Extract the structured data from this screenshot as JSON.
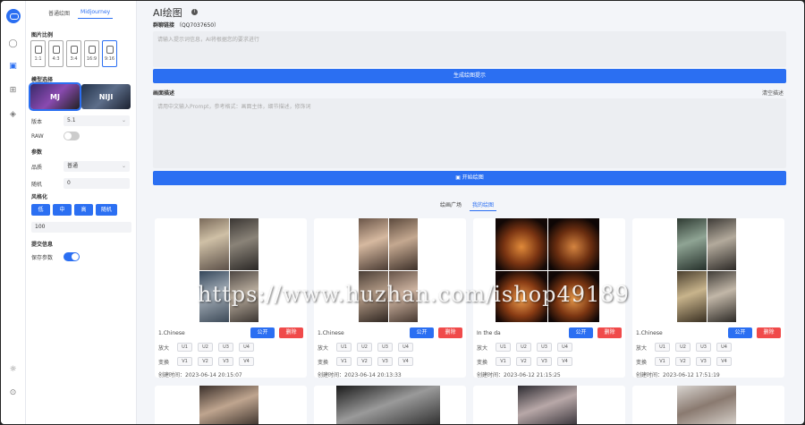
{
  "colors": {
    "accent": "#2b6ff2",
    "danger": "#f04a4a"
  },
  "rail": {
    "icons": [
      "chat-icon",
      "image-icon",
      "apps-icon",
      "palette-icon",
      "sun-icon",
      "logout-icon"
    ]
  },
  "panel": {
    "tabs": [
      "普通绘图",
      "Midjourney"
    ],
    "active_tab": 1,
    "ratio_title": "图片比例",
    "ratios": [
      "1:1",
      "4:3",
      "3:4",
      "16:9",
      "9:16"
    ],
    "selected_ratio": 4,
    "model_title": "模型选择",
    "models": [
      "MJ",
      "NIJI"
    ],
    "version_label": "版本",
    "version_value": "5.1",
    "raw_label": "RAW",
    "raw_on": false,
    "params_title": "参数",
    "quality_label": "品质",
    "quality_value": "普通",
    "seed_label": "随机",
    "seed_value": "0",
    "stylize_title": "风格化",
    "stylize_buttons": [
      "低",
      "中",
      "高",
      "随机"
    ],
    "stylize_value": "100",
    "sync_title": "提交信息",
    "sync_label": "保存参数",
    "sync_on": true
  },
  "main": {
    "title": "AI绘图",
    "group_label": "群聊链接",
    "group_value": "（QQ7037650）",
    "prompt_placeholder": "请输入提示词信息，AI将根据您的要求进行",
    "generate_button": "生成绘图提示",
    "desc_label": "画面描述",
    "desc_right": "清空描述",
    "desc_placeholder": "请用中文输入Prompt，参考格式：画面主体，细节描述，修饰词",
    "start_button": "开始绘图",
    "switch_tabs": [
      "绘画广场",
      "我的绘图"
    ],
    "active_switch": 1
  },
  "cards": [
    {
      "title": "1.Chinese",
      "publish": "公开",
      "delete": "删除",
      "upscale_label": "放大",
      "variation_label": "变换",
      "upscale": [
        "U1",
        "U2",
        "U3",
        "U4"
      ],
      "variation": [
        "V1",
        "V2",
        "V3",
        "V4"
      ],
      "time": "创建时间：2023-06-14 20:15:07"
    },
    {
      "title": "1.Chinese",
      "publish": "公开",
      "delete": "删除",
      "upscale_label": "放大",
      "variation_label": "变换",
      "upscale": [
        "U1",
        "U2",
        "U3",
        "U4"
      ],
      "variation": [
        "V1",
        "V2",
        "V3",
        "V4"
      ],
      "time": "创建时间：2023-06-14 20:13:33"
    },
    {
      "title": "In the da",
      "publish": "公开",
      "delete": "删除",
      "upscale_label": "放大",
      "variation_label": "变换",
      "upscale": [
        "U1",
        "U2",
        "U3",
        "U4"
      ],
      "variation": [
        "V1",
        "V2",
        "V3",
        "V4"
      ],
      "time": "创建时间：2023-06-12 21:15:25"
    },
    {
      "title": "1.Chinese",
      "publish": "公开",
      "delete": "删除",
      "upscale_label": "放大",
      "variation_label": "变换",
      "upscale": [
        "U1",
        "U2",
        "U3",
        "U4"
      ],
      "variation": [
        "V1",
        "V2",
        "V3",
        "V4"
      ],
      "time": "创建时间：2023-06-12 17:51:19"
    }
  ],
  "watermark": "https://www.huzhan.com/ishop49189"
}
